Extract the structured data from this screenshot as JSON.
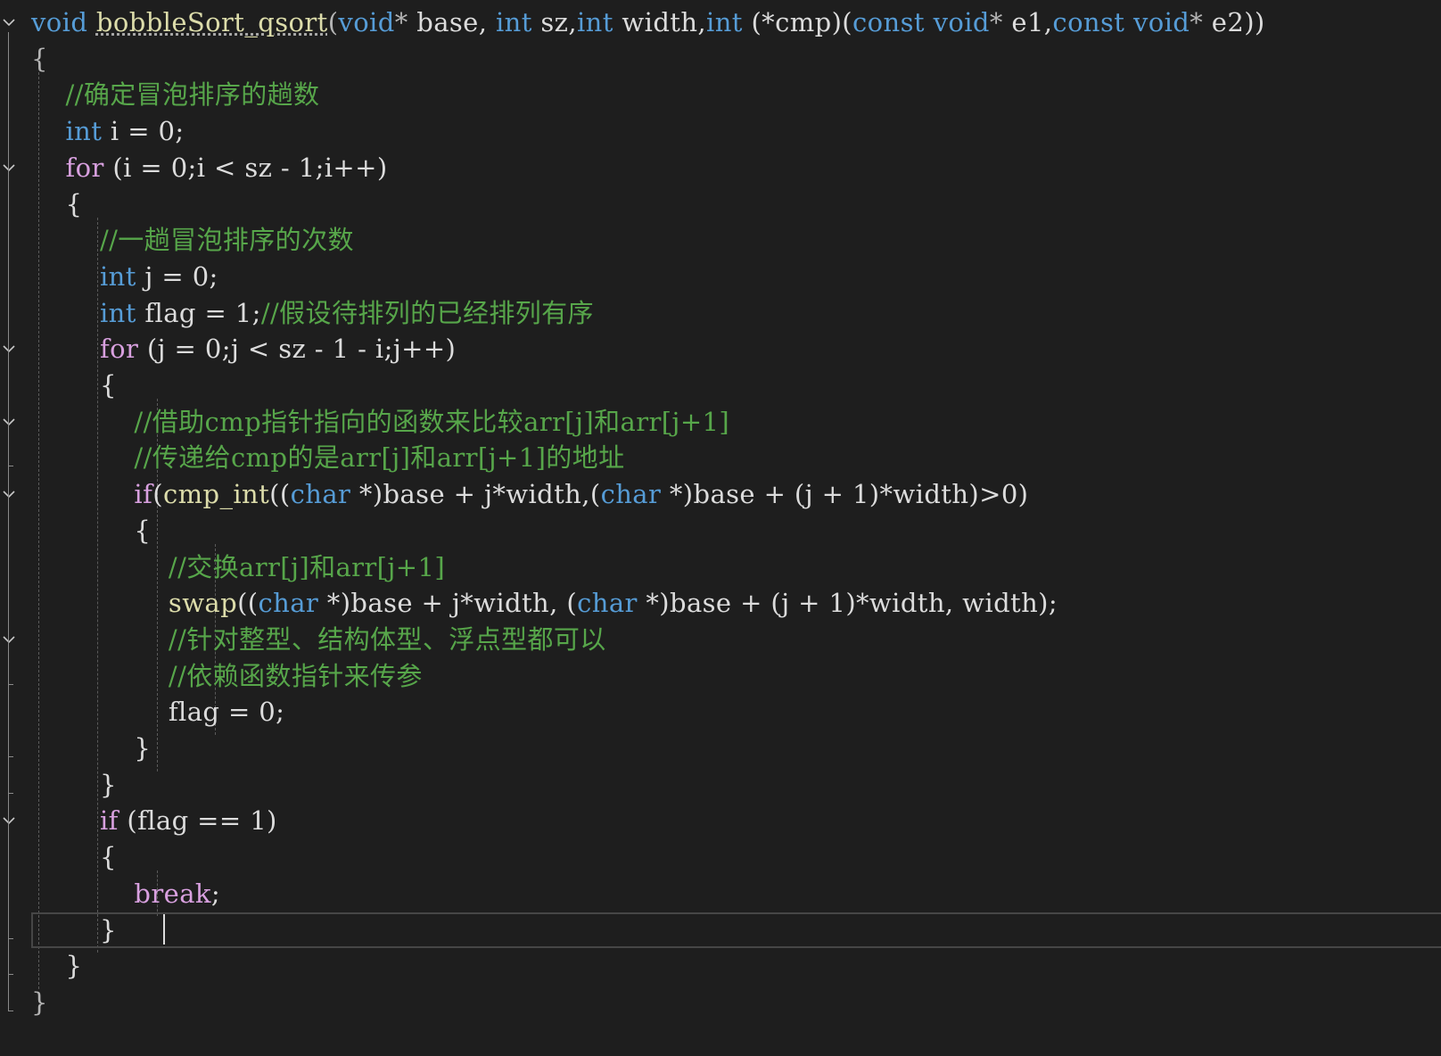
{
  "editor": {
    "lines": [
      [
        [
          "kw",
          "void"
        ],
        [
          "id",
          " "
        ],
        [
          "fn",
          "bobbleSort_qsort"
        ],
        [
          "op",
          "("
        ],
        [
          "kw",
          "void"
        ],
        [
          "op",
          "*"
        ],
        [
          "id",
          " base, "
        ],
        [
          "kw",
          "int"
        ],
        [
          "id",
          " sz,"
        ],
        [
          "kw",
          "int"
        ],
        [
          "id",
          " width,"
        ],
        [
          "kw",
          "int"
        ],
        [
          "id",
          " (*cmp)("
        ],
        [
          "kw",
          "const"
        ],
        [
          "id",
          " "
        ],
        [
          "kw",
          "void"
        ],
        [
          "op",
          "*"
        ],
        [
          "id",
          " e1,"
        ],
        [
          "kw",
          "const"
        ],
        [
          "id",
          " "
        ],
        [
          "kw",
          "void"
        ],
        [
          "op",
          "*"
        ],
        [
          "id",
          " e2))"
        ]
      ],
      [
        [
          "op",
          "{"
        ]
      ],
      [
        [
          "cm",
          "    //确定冒泡排序的趟数"
        ]
      ],
      [
        [
          "id",
          "    "
        ],
        [
          "kw",
          "int"
        ],
        [
          "id",
          " i = 0;"
        ]
      ],
      [
        [
          "id",
          "    "
        ],
        [
          "ctl",
          "for"
        ],
        [
          "id",
          " (i = 0;i < sz - 1;i++)"
        ]
      ],
      [
        [
          "id",
          "    {"
        ]
      ],
      [
        [
          "cm",
          "        //一趟冒泡排序的次数"
        ]
      ],
      [
        [
          "id",
          "        "
        ],
        [
          "kw",
          "int"
        ],
        [
          "id",
          " j = 0;"
        ]
      ],
      [
        [
          "id",
          "        "
        ],
        [
          "kw",
          "int"
        ],
        [
          "id",
          " flag = 1;"
        ],
        [
          "cm",
          "//假设待排列的已经排列有序"
        ]
      ],
      [
        [
          "id",
          "        "
        ],
        [
          "ctl",
          "for"
        ],
        [
          "id",
          " (j = 0;j < sz - 1 - i;j++)"
        ]
      ],
      [
        [
          "id",
          "        {"
        ]
      ],
      [
        [
          "cm",
          "            //借助cmp指针指向的函数来比较arr[j]和arr[j+1]"
        ]
      ],
      [
        [
          "cm",
          "            //传递给cmp的是arr[j]和arr[j+1]的地址"
        ]
      ],
      [
        [
          "id",
          "            "
        ],
        [
          "ctl",
          "if"
        ],
        [
          "id",
          "("
        ],
        [
          "fn",
          "cmp_int"
        ],
        [
          "id",
          "(("
        ],
        [
          "kw",
          "char"
        ],
        [
          "id",
          " *)base + j*width,("
        ],
        [
          "kw",
          "char"
        ],
        [
          "id",
          " *)base + (j + 1)*width)>0)"
        ]
      ],
      [
        [
          "id",
          "            {"
        ]
      ],
      [
        [
          "cm",
          "                //交换arr[j]和arr[j+1]"
        ]
      ],
      [
        [
          "id",
          "                "
        ],
        [
          "fn",
          "swap"
        ],
        [
          "id",
          "(("
        ],
        [
          "kw",
          "char"
        ],
        [
          "id",
          " *)base + j*width, ("
        ],
        [
          "kw",
          "char"
        ],
        [
          "id",
          " *)base + (j + 1)*width, width);"
        ]
      ],
      [
        [
          "cm",
          "                //针对整型、结构体型、浮点型都可以"
        ]
      ],
      [
        [
          "cm",
          "                //依赖函数指针来传参"
        ]
      ],
      [
        [
          "id",
          "                flag = 0;"
        ]
      ],
      [
        [
          "id",
          "            }"
        ]
      ],
      [
        [
          "id",
          "        }"
        ]
      ],
      [
        [
          "id",
          "        "
        ],
        [
          "ctl",
          "if"
        ],
        [
          "id",
          " (flag == 1)"
        ]
      ],
      [
        [
          "id",
          "        {"
        ]
      ],
      [
        [
          "id",
          "            "
        ],
        [
          "ctl",
          "break"
        ],
        [
          "id",
          ";"
        ]
      ],
      [
        [
          "id",
          "        }"
        ]
      ],
      [
        [
          "id",
          "    }"
        ]
      ],
      [
        [
          "op",
          "}"
        ]
      ]
    ],
    "fold_icons": [
      "chevron-down-icon",
      "chevron-down-icon",
      "chevron-down-icon",
      "chevron-down-icon",
      "chevron-down-icon",
      "chevron-down-icon",
      "chevron-down-icon"
    ],
    "colors": {
      "background": "#1e1e1e",
      "keyword": "#569cd6",
      "control": "#d8a0df",
      "comment": "#57a64a",
      "function": "#dcdcaa",
      "text": "#dcdcdc"
    }
  }
}
